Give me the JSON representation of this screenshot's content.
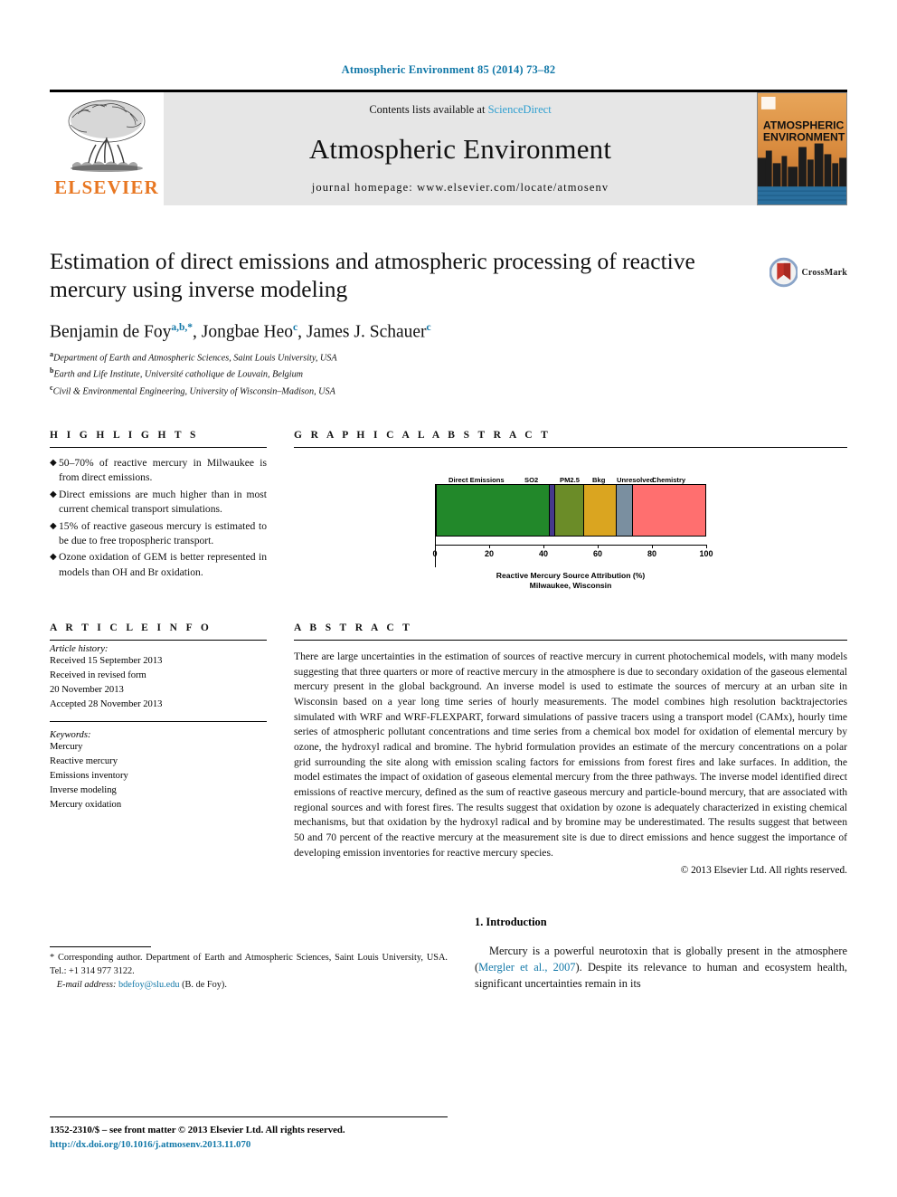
{
  "running_head": "Atmospheric Environment 85 (2014) 73–82",
  "masthead": {
    "publisher": "ELSEVIER",
    "contents_prefix": "Contents lists available at ",
    "sciencedirect": "ScienceDirect",
    "journal_title": "Atmospheric Environment",
    "homepage": "journal homepage: www.elsevier.com/locate/atmosenv",
    "cover_line1": "ATMOSPHERIC",
    "cover_line2": "ENVIRONMENT"
  },
  "article": {
    "title": "Estimation of direct emissions and atmospheric processing of reactive mercury using inverse modeling",
    "crossmark_label": "CrossMark",
    "authors": [
      {
        "name": "Benjamin de Foy",
        "sup": "a,b,*"
      },
      {
        "name": "Jongbae Heo",
        "sup": "c"
      },
      {
        "name": "James J. Schauer",
        "sup": "c"
      }
    ],
    "affiliations": [
      {
        "marker": "a",
        "text": "Department of Earth and Atmospheric Sciences, Saint Louis University, USA"
      },
      {
        "marker": "b",
        "text": "Earth and Life Institute, Université catholique de Louvain, Belgium"
      },
      {
        "marker": "c",
        "text": "Civil & Environmental Engineering, University of Wisconsin–Madison, USA"
      }
    ]
  },
  "highlights": {
    "heading": "H I G H L I G H T S",
    "items": [
      "50–70% of reactive mercury in Milwaukee is from direct emissions.",
      "Direct emissions are much higher than in most current chemical transport simulations.",
      "15% of reactive gaseous mercury is estimated to be due to free tropospheric transport.",
      "Ozone oxidation of GEM is better represented in models than OH and Br oxidation."
    ]
  },
  "graphical_abstract": {
    "heading": "G R A P H I C A L   A B S T R A C T"
  },
  "chart_data": {
    "type": "bar",
    "orientation": "horizontal",
    "stacked": true,
    "title": "",
    "xlabel": "Reactive Mercury Source Attribution (%)",
    "sublabel": "Milwaukee, Wisconsin",
    "ylabel": "",
    "xlim": [
      0,
      100
    ],
    "ticks": [
      0,
      20,
      40,
      60,
      80,
      100
    ],
    "grid": false,
    "legend_position": "above-bar",
    "categories": [
      "Direct Emissions",
      "SO2",
      "PM2.5",
      "Bkg",
      "Unresolved",
      "Chemistry"
    ],
    "values": [
      42,
      2,
      11,
      12,
      6,
      27
    ],
    "cumulative": [
      42,
      44,
      55,
      67,
      73,
      100
    ],
    "colors": [
      "#22882a",
      "#46398c",
      "#6b8c28",
      "#daa520",
      "#7a8fa0",
      "#ff6f6f"
    ]
  },
  "article_info": {
    "heading": "A R T I C L E   I N F O",
    "history_label": "Article history:",
    "history": [
      "Received 15 September 2013",
      "Received in revised form",
      "20 November 2013",
      "Accepted 28 November 2013"
    ],
    "keywords_label": "Keywords:",
    "keywords": [
      "Mercury",
      "Reactive mercury",
      "Emissions inventory",
      "Inverse modeling",
      "Mercury oxidation"
    ]
  },
  "abstract": {
    "heading": "A B S T R A C T",
    "text": "There are large uncertainties in the estimation of sources of reactive mercury in current photochemical models, with many models suggesting that three quarters or more of reactive mercury in the atmosphere is due to secondary oxidation of the gaseous elemental mercury present in the global background. An inverse model is used to estimate the sources of mercury at an urban site in Wisconsin based on a year long time series of hourly measurements. The model combines high resolution backtrajectories simulated with WRF and WRF-FLEXPART, forward simulations of passive tracers using a transport model (CAMx), hourly time series of atmospheric pollutant concentrations and time series from a chemical box model for oxidation of elemental mercury by ozone, the hydroxyl radical and bromine. The hybrid formulation provides an estimate of the mercury concentrations on a polar grid surrounding the site along with emission scaling factors for emissions from forest fires and lake surfaces. In addition, the model estimates the impact of oxidation of gaseous elemental mercury from the three pathways. The inverse model identified direct emissions of reactive mercury, defined as the sum of reactive gaseous mercury and particle-bound mercury, that are associated with regional sources and with forest fires. The results suggest that oxidation by ozone is adequately characterized in existing chemical mechanisms, but that oxidation by the hydroxyl radical and by bromine may be underestimated. The results suggest that between 50 and 70 percent of the reactive mercury at the measurement site is due to direct emissions and hence suggest the importance of developing emission inventories for reactive mercury species.",
    "copyright": "© 2013 Elsevier Ltd. All rights reserved."
  },
  "introduction": {
    "heading": "1.  Introduction",
    "para_pre": "Mercury is a powerful neurotoxin that is globally present in the atmosphere (",
    "citation": "Mergler et al., 2007",
    "para_post": "). Despite its relevance to human and ecosystem health, significant uncertainties remain in its"
  },
  "footnote": {
    "corresponding": "* Corresponding author. Department of Earth and Atmospheric Sciences, Saint Louis University, USA. Tel.: +1 314 977 3122.",
    "email_label": "E-mail address:",
    "email": "bdefoy@slu.edu",
    "email_suffix": "(B. de Foy)."
  },
  "footer": {
    "issn_line": "1352-2310/$ – see front matter © 2013 Elsevier Ltd. All rights reserved.",
    "doi": "http://dx.doi.org/10.1016/j.atmosenv.2013.11.070"
  }
}
